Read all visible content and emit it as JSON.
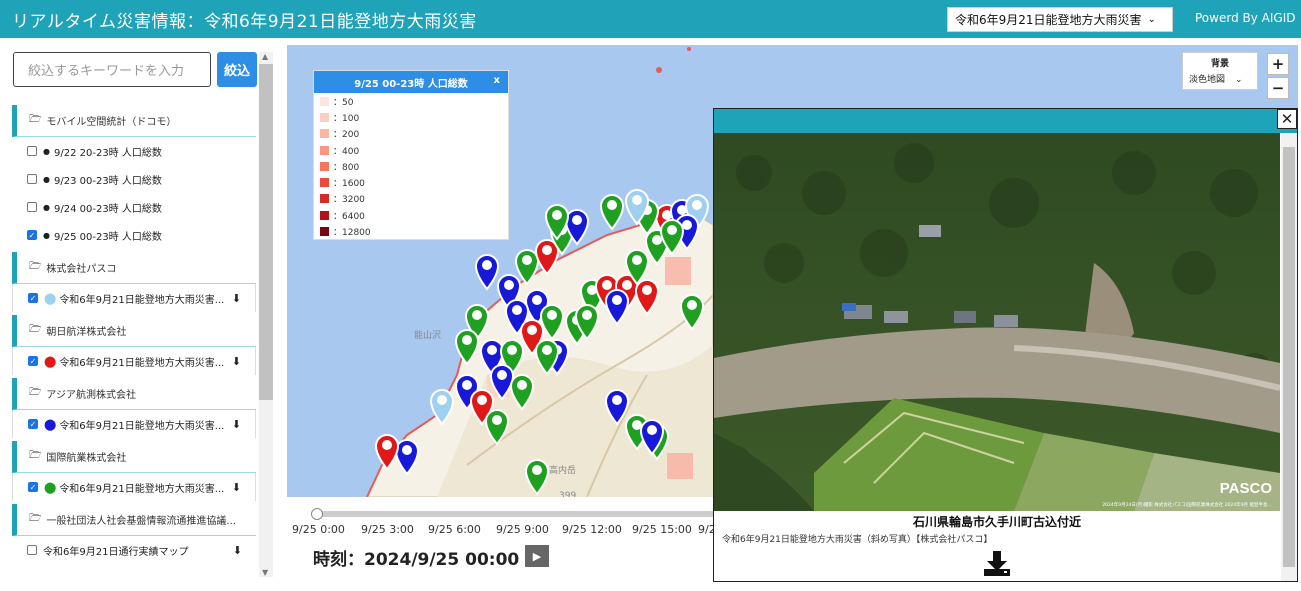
{
  "header": {
    "title": "リアルタイム災害情報：令和6年9月21日能登地方大雨災害",
    "disaster_select": "令和6年9月21日能登地方大雨災害",
    "powered": "Powerd By AIGID"
  },
  "sidebar": {
    "search_placeholder": "絞込するキーワードを入力",
    "search_button": "絞込",
    "groups": [
      {
        "name": "モバイル空間統計（ドコモ）"
      },
      {
        "name": "株式会社パスコ"
      },
      {
        "name": "朝日航洋株式会社"
      },
      {
        "name": "アジア航測株式会社"
      },
      {
        "name": "国際航業株式会社"
      },
      {
        "name": "一般社団法人社会基盤情報流通推進協議..."
      }
    ],
    "docomo_items": [
      {
        "label": "9/22 20-23時 人口総数",
        "checked": false
      },
      {
        "label": "9/23 00-23時 人口総数",
        "checked": false
      },
      {
        "label": "9/24 00-23時 人口総数",
        "checked": false
      },
      {
        "label": "9/25 00-23時 人口総数",
        "checked": true
      }
    ],
    "layer_item_label": "令和6年9月21日能登地方大雨災害...",
    "pin_colors": [
      "#9fd0f0",
      "#e01818",
      "#1818d8",
      "#20a020"
    ],
    "last_item_label": "令和6年9月21日通行実績マップ"
  },
  "legend": {
    "title": "9/25 00-23時 人口総数",
    "close": "x",
    "rows": [
      {
        "label": "：50",
        "color": "#fde6de"
      },
      {
        "label": "：100",
        "color": "#fcd0c0"
      },
      {
        "label": "：200",
        "color": "#fbb6a0"
      },
      {
        "label": "：400",
        "color": "#f99780"
      },
      {
        "label": "：800",
        "color": "#f57560"
      },
      {
        "label": "：1600",
        "color": "#ec4b3c"
      },
      {
        "label": "：3200",
        "color": "#d52a27"
      },
      {
        "label": "：6400",
        "color": "#b21318"
      },
      {
        "label": "：12800",
        "color": "#7a0510"
      }
    ]
  },
  "map_controls": {
    "bg_label": "背景",
    "bg_value": "淡色地図",
    "zoom_in": "+",
    "zoom_out": "−"
  },
  "map_labels": {
    "terrain_1": "能山沢",
    "terrain_2": "高内岳",
    "elevation": "399"
  },
  "timeline": {
    "ticks": [
      "9/25 0:00",
      "9/25 3:00",
      "9/25 6:00",
      "9/25 9:00",
      "9/25 12:00",
      "9/25 15:00",
      "9/2"
    ],
    "current": "時刻：2024/9/25 00:00"
  },
  "popup": {
    "place": "石川県輪島市久手川町古込付近",
    "caption": "令和6年9月21日能登地方大雨災害（斜め写真）【株式会社パスコ】",
    "logo": "PASCO",
    "photo_credit": "2024年9月24日(月)撮影 株式会社パスコ/国際航業株式会社 2024年9月 能登半島…"
  }
}
